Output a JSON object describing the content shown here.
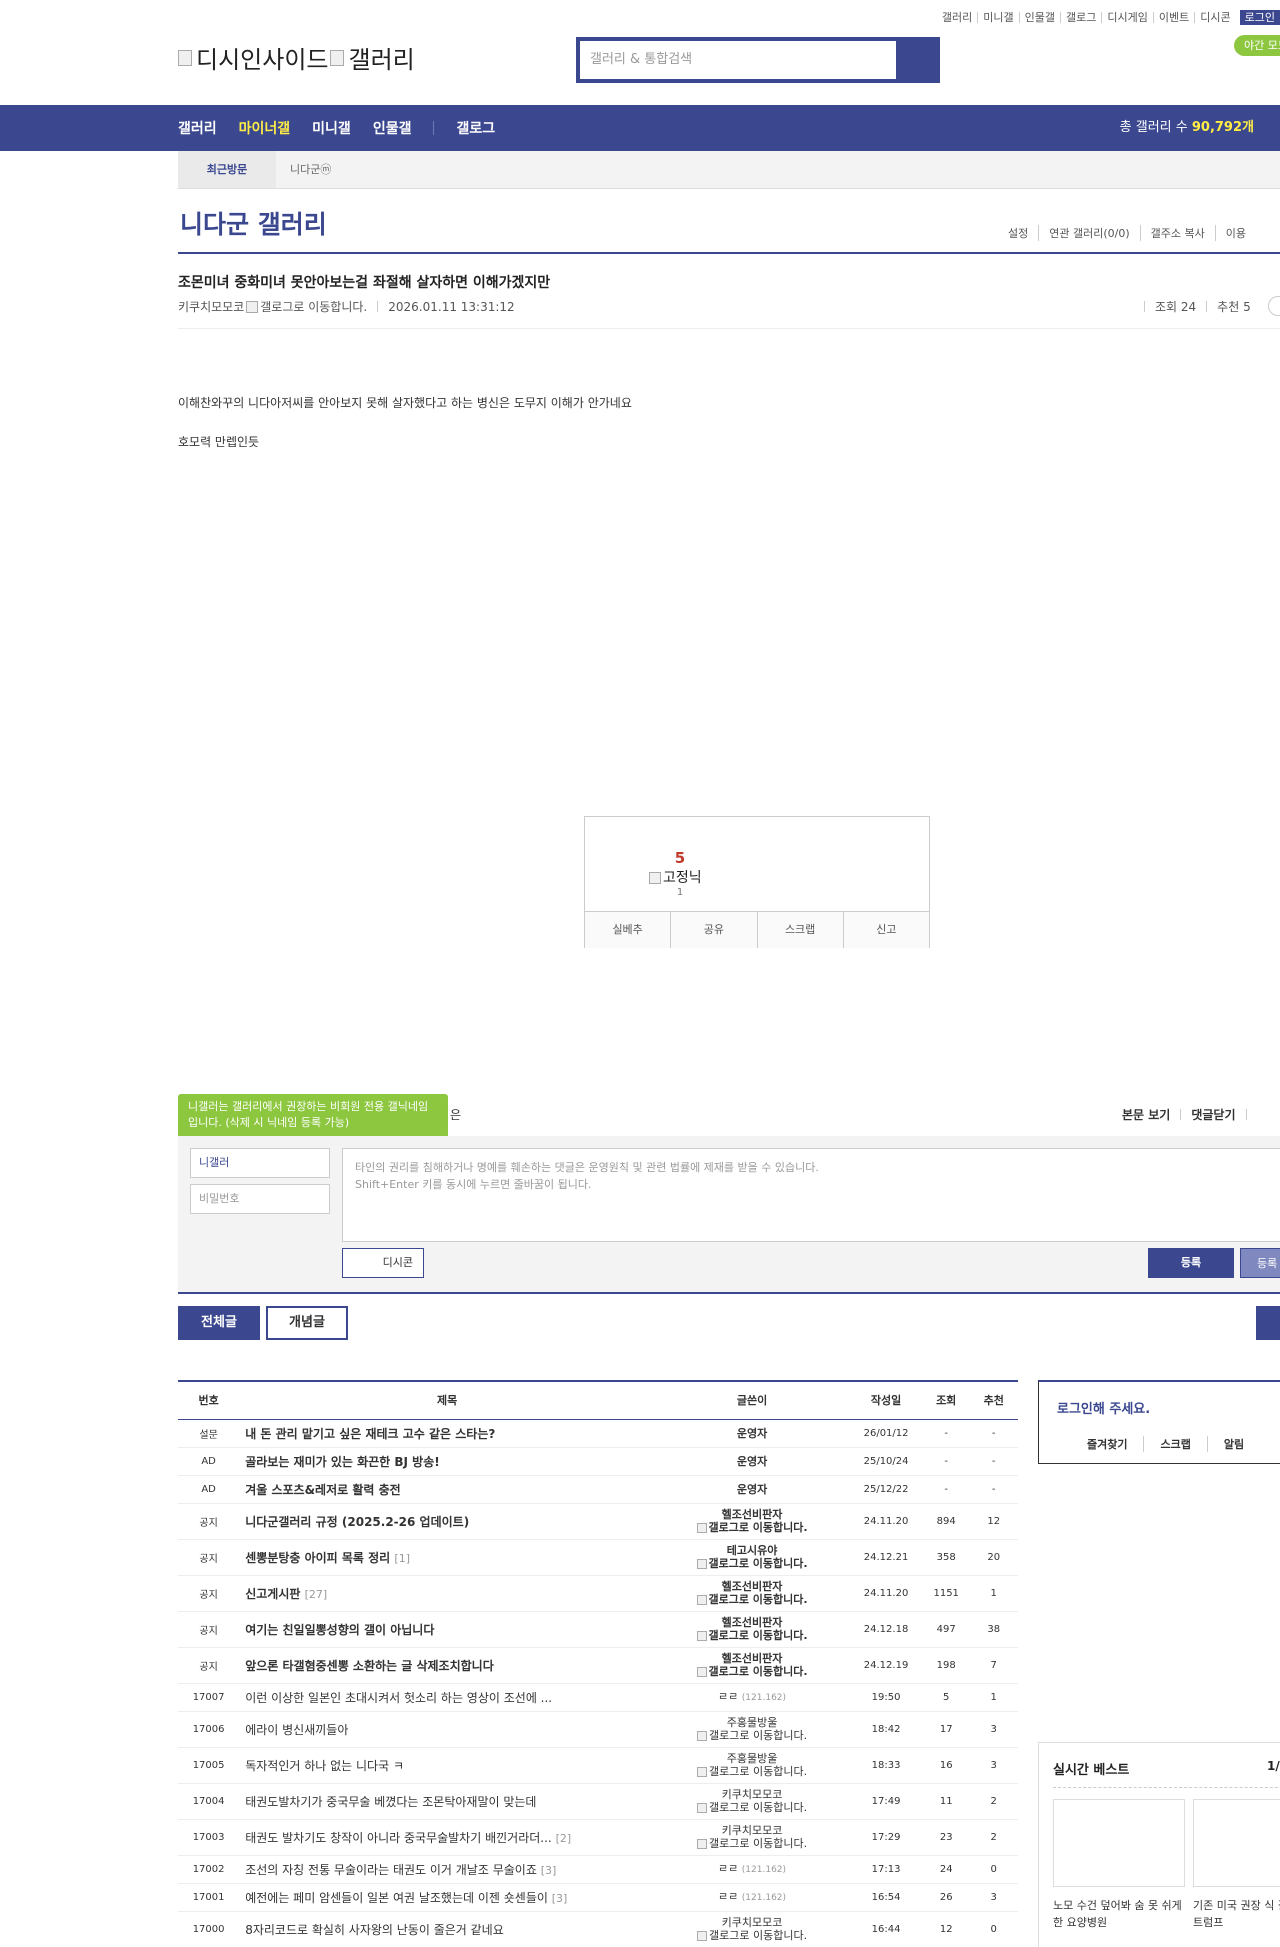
{
  "top_links": [
    "갤러리",
    "미니갤",
    "인물갤",
    "갤로그",
    "디시게임",
    "이벤트",
    "디시콘"
  ],
  "login_label": "로그인",
  "night_mode_label": "야간 모드",
  "logo": {
    "text1": "디시인사이드",
    "text2": "갤러리"
  },
  "search": {
    "placeholder": "갤러리 & 통합검색"
  },
  "gnb": {
    "items": [
      "갤러리",
      "마이너갤",
      "미니갤",
      "인물갤",
      "갤로그"
    ],
    "active": "마이너갤",
    "total_label": "총 갤러리 수",
    "total_value": "90,792개"
  },
  "recent": {
    "label": "최근방문",
    "item": "니다군ⓜ"
  },
  "gallery": {
    "title": "니다군 갤러리",
    "menu": [
      "설정",
      "연관 갤러리(0/0)",
      "갤주소 복사",
      "이용"
    ]
  },
  "post": {
    "title": "조몬미녀 중화미녀 못안아보는걸 좌절해 살자하면 이해가겠지만",
    "author": "키쿠치모모코",
    "gallog_img_alt": "갤로그로 이동합니다.",
    "date": "2026.01.11 13:31:12",
    "views": "조회 24",
    "recommends": "추천 5",
    "body_lines": [
      "이해찬와꾸의 니다아저씨를 안아보지 못해 살자했다고 하는 병신은 도무지 이해가 안가네요",
      "호모력 만렙인듯"
    ]
  },
  "recommend": {
    "count": "5",
    "fixed_alt": "고정닉",
    "fixed_count": "1",
    "buttons": [
      "실베추",
      "공유",
      "스크랩",
      "신고"
    ]
  },
  "comment": {
    "tip": "니갤러는 갤러리에서 권장하는 비회원 전용 갤닉네임입니다. (삭제 시 닉네임 등록 가능)",
    "tip_tail": "은",
    "view_body": "본문 보기",
    "close_comments": "댓글닫기",
    "nick": "니갤러",
    "password": "비밀번호",
    "textarea_line1": "타인의 권리를 침해하거나 명예를 훼손하는 댓글은 운영원칙 및 관련 법률에 제재를 받을 수 있습니다.",
    "textarea_line2": "Shift+Enter 키를 동시에 누르면 줄바꿈이 됩니다.",
    "dccon": "디시콘",
    "submit": "등록",
    "submit2": "등록"
  },
  "list_tabs": [
    "전체글",
    "개념글"
  ],
  "table": {
    "headers": [
      "번호",
      "제목",
      "글쓴이",
      "작성일",
      "조회",
      "추천"
    ],
    "rows": [
      {
        "no": "설문",
        "title": "내 돈 관리 맡기고 싶은 재테크 고수 같은 스타는?",
        "reply": "",
        "writer": "운영자",
        "ip": "",
        "gallog": "",
        "date": "26/01/12",
        "views": "-",
        "rec": "-",
        "bold": true
      },
      {
        "no": "AD",
        "title": "골라보는 재미가 있는 화끈한 BJ 방송!",
        "reply": "",
        "writer": "운영자",
        "ip": "",
        "gallog": "",
        "date": "25/10/24",
        "views": "-",
        "rec": "-",
        "bold": true
      },
      {
        "no": "AD",
        "title": "겨울 스포츠&레저로 활력 충전",
        "reply": "",
        "writer": "운영자",
        "ip": "",
        "gallog": "",
        "date": "25/12/22",
        "views": "-",
        "rec": "-",
        "bold": true
      },
      {
        "no": "공지",
        "title": "니다군갤러리 규정 (2025.2-26 업데이트)",
        "reply": "",
        "writer": "헬조선비판자",
        "ip": "",
        "gallog": "갤로그로 이동합니다.",
        "date": "24.11.20",
        "views": "894",
        "rec": "12",
        "bold": true
      },
      {
        "no": "공지",
        "title": "센뽕분탕충 아이피 목록 정리",
        "reply": "[1]",
        "writer": "테고시유야",
        "ip": "",
        "gallog": "갤로그로 이동합니다.",
        "date": "24.12.21",
        "views": "358",
        "rec": "20",
        "bold": true
      },
      {
        "no": "공지",
        "title": "신고게시판",
        "reply": "[27]",
        "writer": "헬조선비판자",
        "ip": "",
        "gallog": "갤로그로 이동합니다.",
        "date": "24.11.20",
        "views": "1151",
        "rec": "1",
        "bold": true
      },
      {
        "no": "공지",
        "title": "여기는 친일일뽕성향의 갤이 아닙니다",
        "reply": "",
        "writer": "헬조선비판자",
        "ip": "",
        "gallog": "갤로그로 이동합니다.",
        "date": "24.12.18",
        "views": "497",
        "rec": "38",
        "bold": true
      },
      {
        "no": "공지",
        "title": "앞으론 타갤혐중센뽕 소환하는 글 삭제조치합니다",
        "reply": "",
        "writer": "헬조선비판자",
        "ip": "",
        "gallog": "갤로그로 이동합니다.",
        "date": "24.12.19",
        "views": "198",
        "rec": "7",
        "bold": true
      },
      {
        "no": "17007",
        "title": "이런 이상한 일본인 초대시켜서 헛소리 하는 영상이 조선에 ...",
        "reply": "",
        "writer": "ㄹㄹ",
        "ip": "(121.162)",
        "gallog": "",
        "date": "19:50",
        "views": "5",
        "rec": "1",
        "bold": false
      },
      {
        "no": "17006",
        "title": "에라이 병신새끼들아",
        "reply": "",
        "writer": "주홍물방울",
        "ip": "",
        "gallog": "갤로그로 이동합니다.",
        "date": "18:42",
        "views": "17",
        "rec": "3",
        "bold": false
      },
      {
        "no": "17005",
        "title": "독자적인거 하나 없는 니다국 ㅋ",
        "reply": "",
        "writer": "주홍물방울",
        "ip": "",
        "gallog": "갤로그로 이동합니다.",
        "date": "18:33",
        "views": "16",
        "rec": "3",
        "bold": false
      },
      {
        "no": "17004",
        "title": "태권도발차기가 중국무술 베꼈다는 조몬탁아재말이 맞는데",
        "reply": "",
        "writer": "키쿠치모모코",
        "ip": "",
        "gallog": "갤로그로 이동합니다.",
        "date": "17:49",
        "views": "11",
        "rec": "2",
        "bold": false
      },
      {
        "no": "17003",
        "title": "태권도 발차기도 창작이 아니라 중국무술발차기 배낀거라더...",
        "reply": "[2]",
        "writer": "키쿠치모모코",
        "ip": "",
        "gallog": "갤로그로 이동합니다.",
        "date": "17:29",
        "views": "23",
        "rec": "2",
        "bold": false
      },
      {
        "no": "17002",
        "title": "조선의 자칭 전통 무술이라는 태권도 이거 개날조 무술이죠",
        "reply": "[3]",
        "writer": "ㄹㄹ",
        "ip": "(121.162)",
        "gallog": "",
        "date": "17:13",
        "views": "24",
        "rec": "0",
        "bold": false
      },
      {
        "no": "17001",
        "title": "예전에는 페미 암센들이 일본 여권 날조했는데 이젠 숏센들이",
        "reply": "[3]",
        "writer": "ㄹㄹ",
        "ip": "(121.162)",
        "gallog": "",
        "date": "16:54",
        "views": "26",
        "rec": "3",
        "bold": false
      },
      {
        "no": "17000",
        "title": "8자리코드로 확실히 사자왕의 난동이 줄은거 같네요",
        "reply": "",
        "writer": "키쿠치모모코",
        "ip": "",
        "gallog": "갤로그로 이동합니다.",
        "date": "16:44",
        "views": "12",
        "rec": "0",
        "bold": false
      }
    ]
  },
  "side_login": {
    "title": "로그인해 주세요.",
    "links": [
      "즐겨찾기",
      "스크랩",
      "알림"
    ]
  },
  "side_best": {
    "title": "실시간 베스트",
    "page": "1/",
    "captions": [
      "노모 수건 덮어봐 숨 못 쉬게한 요양병원",
      "기존 미국 권장 식 갈아엎은 트럼프"
    ]
  }
}
